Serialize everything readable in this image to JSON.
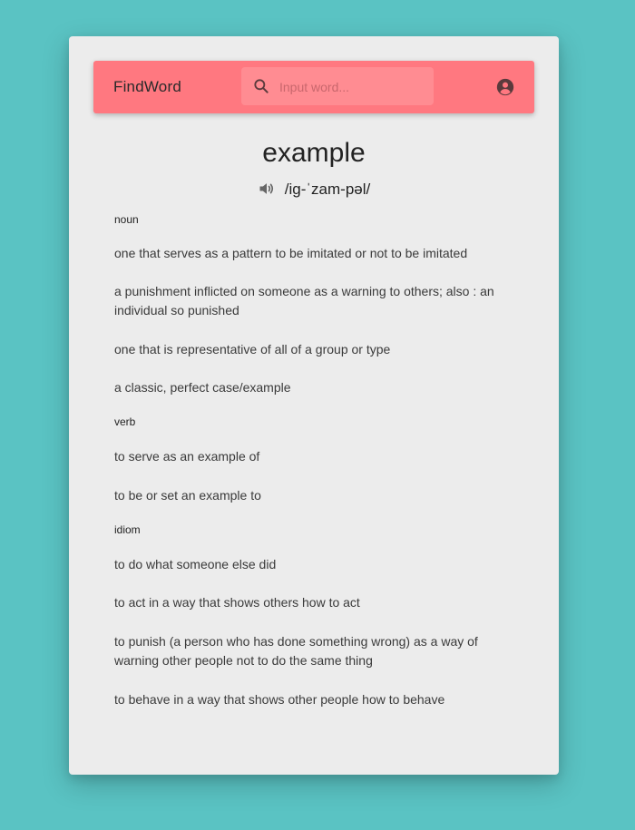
{
  "header": {
    "brand": "FindWord",
    "search_placeholder": "Input word...",
    "search_value": ""
  },
  "entry": {
    "word": "example",
    "pronunciation": "/ig-ˈzam-pəl/"
  },
  "sections": [
    {
      "pos": "noun",
      "definitions": [
        "one that serves as a pattern to be imitated or not to be imitated",
        "a punishment inflicted on someone as a warning to others; also : an individual so punished",
        "one that is representative of all of a group or type",
        "a classic, perfect case/example"
      ]
    },
    {
      "pos": "verb",
      "definitions": [
        "to serve as an example of",
        "to be or set an example to"
      ]
    },
    {
      "pos": "idiom",
      "definitions": [
        "to do what someone else did",
        "to act in a way that shows others how to act",
        "to punish (a person who has done something wrong) as a way of warning other people not to do the same thing",
        "to behave in a way that shows other people how to behave"
      ]
    }
  ],
  "colors": {
    "background": "#5ac3c3",
    "card": "#ececec",
    "appbar": "#ff7880",
    "search_field": "#ff8c92"
  },
  "icons": {
    "search": "search-icon",
    "account": "account-circle-icon",
    "speaker": "volume-icon"
  }
}
